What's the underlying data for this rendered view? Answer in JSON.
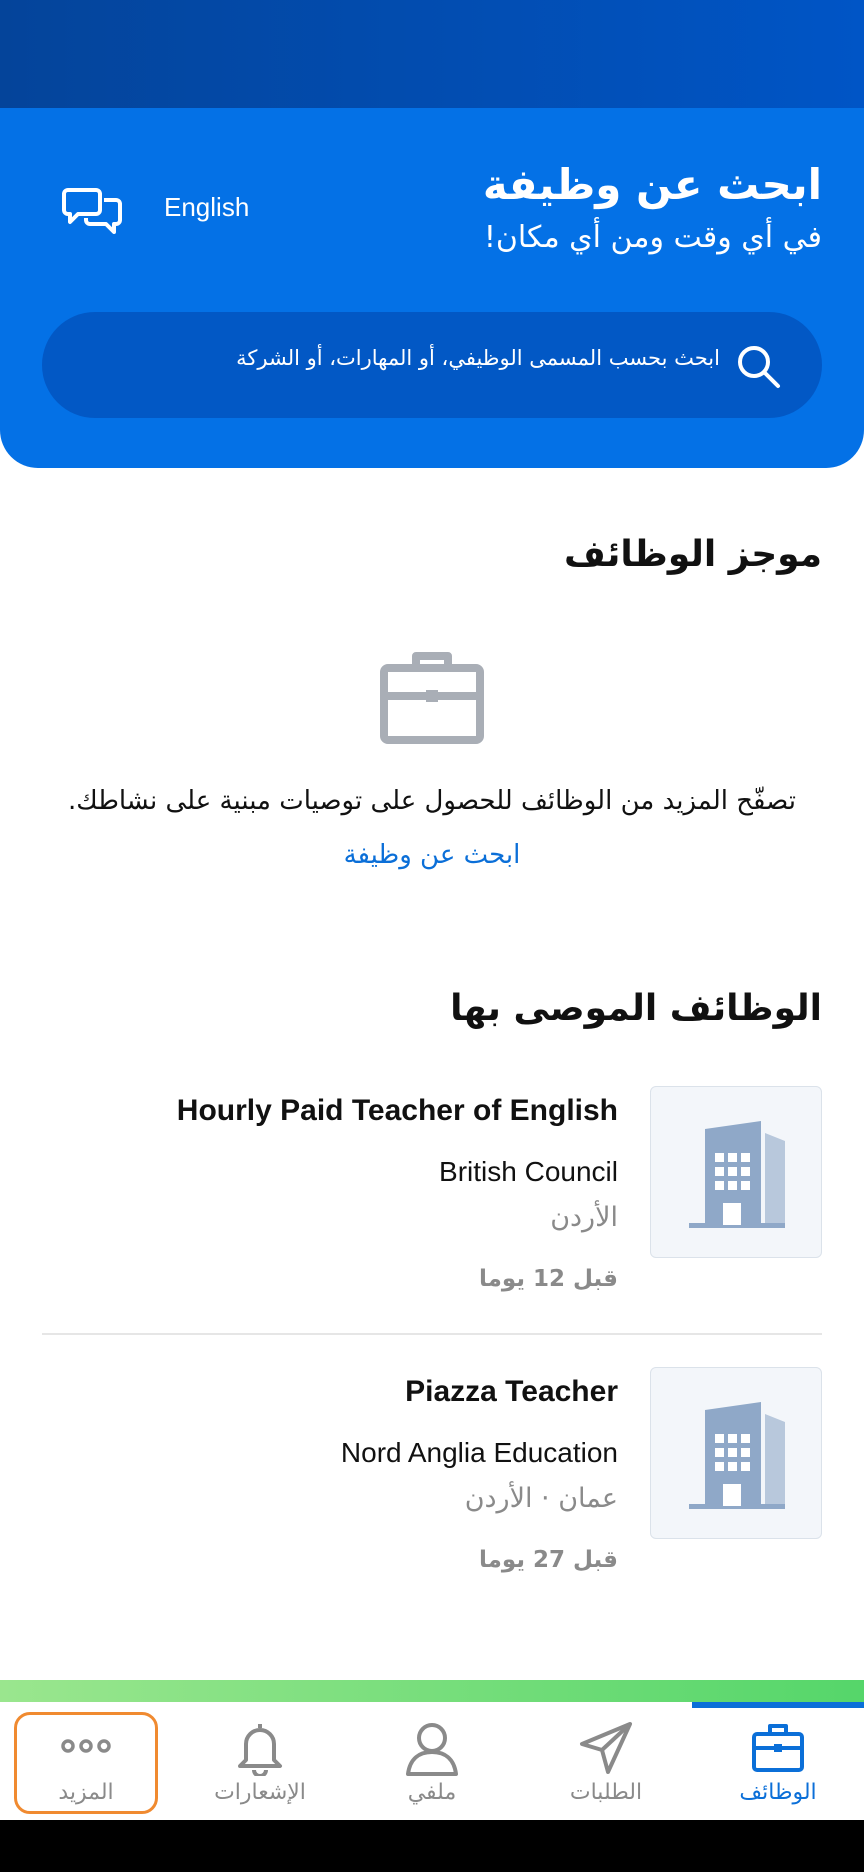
{
  "hero": {
    "title": "ابحث عن وظيفة",
    "subtitle": "في أي وقت ومن أي مكان!",
    "language_label": "English",
    "chat_icon": "chat-bubbles-icon"
  },
  "search": {
    "placeholder": "ابحث بحسب المسمى الوظيفي، أو المهارات، أو الشركة",
    "icon": "search-icon"
  },
  "feed": {
    "title": "موجز الوظائف",
    "empty_icon": "briefcase-icon",
    "empty_text": "تصفّح المزيد من الوظائف للحصول على توصيات مبنية على نشاطك.",
    "empty_link": "ابحث عن وظيفة"
  },
  "recommended": {
    "title": "الوظائف الموصى بها",
    "jobs": [
      {
        "title": "Hourly Paid Teacher of English",
        "company": "British Council",
        "location": "الأردن",
        "posted": "قبل 12 يوما",
        "logo_icon": "building-icon"
      },
      {
        "title": "Piazza Teacher",
        "company": "Nord Anglia Education",
        "location": "عمان · الأردن",
        "posted": "قبل 27 يوما",
        "logo_icon": "building-icon"
      }
    ]
  },
  "nav": {
    "items": [
      {
        "label": "الوظائف",
        "icon": "briefcase-icon",
        "active": true
      },
      {
        "label": "الطلبات",
        "icon": "send-icon",
        "active": false
      },
      {
        "label": "ملفي",
        "icon": "user-icon",
        "active": false
      },
      {
        "label": "الإشعارات",
        "icon": "bell-icon",
        "active": false
      },
      {
        "label": "المزيد",
        "icon": "more-dots-icon",
        "active": false
      }
    ]
  },
  "colors": {
    "primary": "#0471e6",
    "search_bg": "#0258c5",
    "link": "#0b6fd8",
    "muted": "#8a8a8a",
    "highlight": "#f08a30"
  }
}
